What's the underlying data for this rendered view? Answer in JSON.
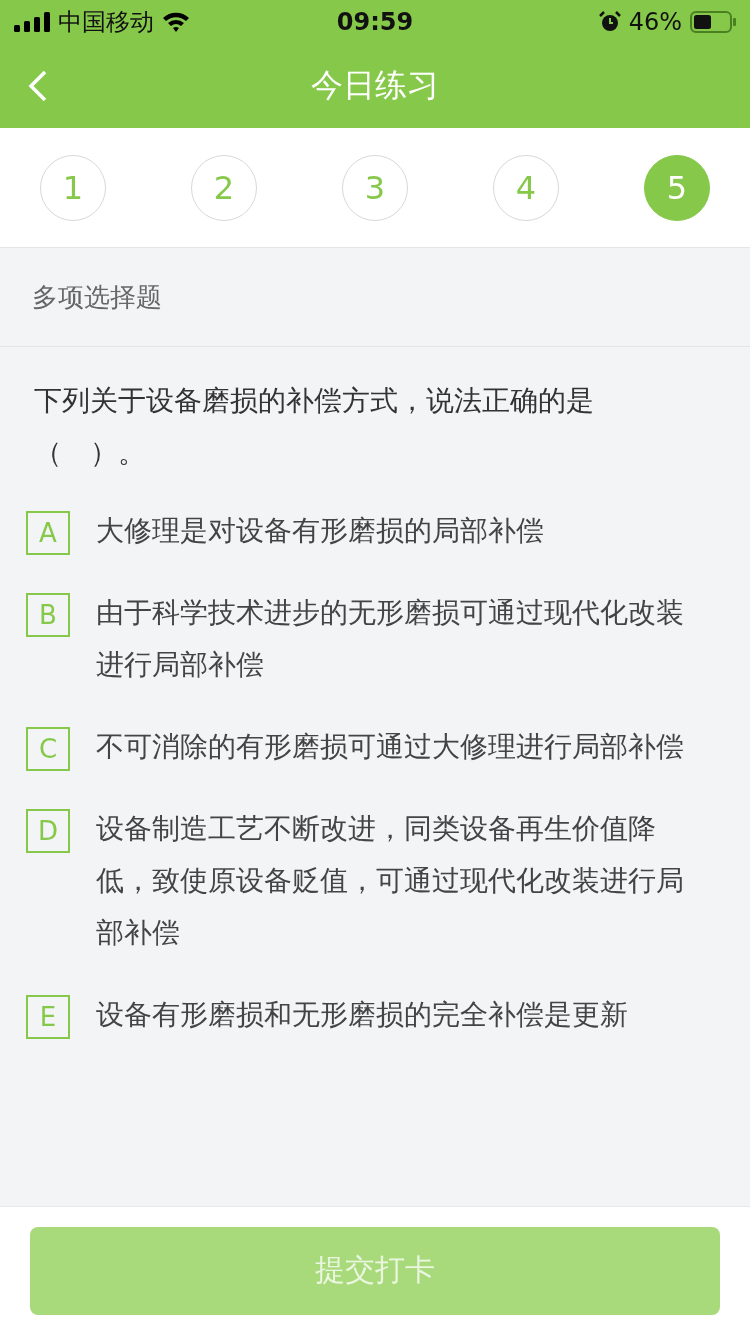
{
  "status_bar": {
    "carrier": "中国移动",
    "time": "09:59",
    "battery": "46%"
  },
  "nav": {
    "title": "今日练习"
  },
  "steps": [
    {
      "label": "1",
      "selected": false
    },
    {
      "label": "2",
      "selected": false
    },
    {
      "label": "3",
      "selected": false
    },
    {
      "label": "4",
      "selected": false
    },
    {
      "label": "5",
      "selected": true
    }
  ],
  "question_type": "多项选择题",
  "question": "下列关于设备磨损的补偿方式，说法正确的是（　）。",
  "options": [
    {
      "letter": "A",
      "text": "大修理是对设备有形磨损的局部补偿",
      "selected": false
    },
    {
      "letter": "B",
      "text": "由于科学技术进步的无形磨损可通过现代化改装进行局部补偿",
      "selected": false
    },
    {
      "letter": "C",
      "text": "不可消除的有形磨损可通过大修理进行局部补偿",
      "selected": false
    },
    {
      "letter": "D",
      "text": "设备制造工艺不断改进，同类设备再生价值降低，致使原设备贬值，可通过现代化改装进行局部补偿",
      "selected": false
    },
    {
      "letter": "E",
      "text": "设备有形磨损和无形磨损的完全补偿是更新",
      "selected": false
    }
  ],
  "submit": {
    "label": "提交打卡",
    "disabled": true
  }
}
